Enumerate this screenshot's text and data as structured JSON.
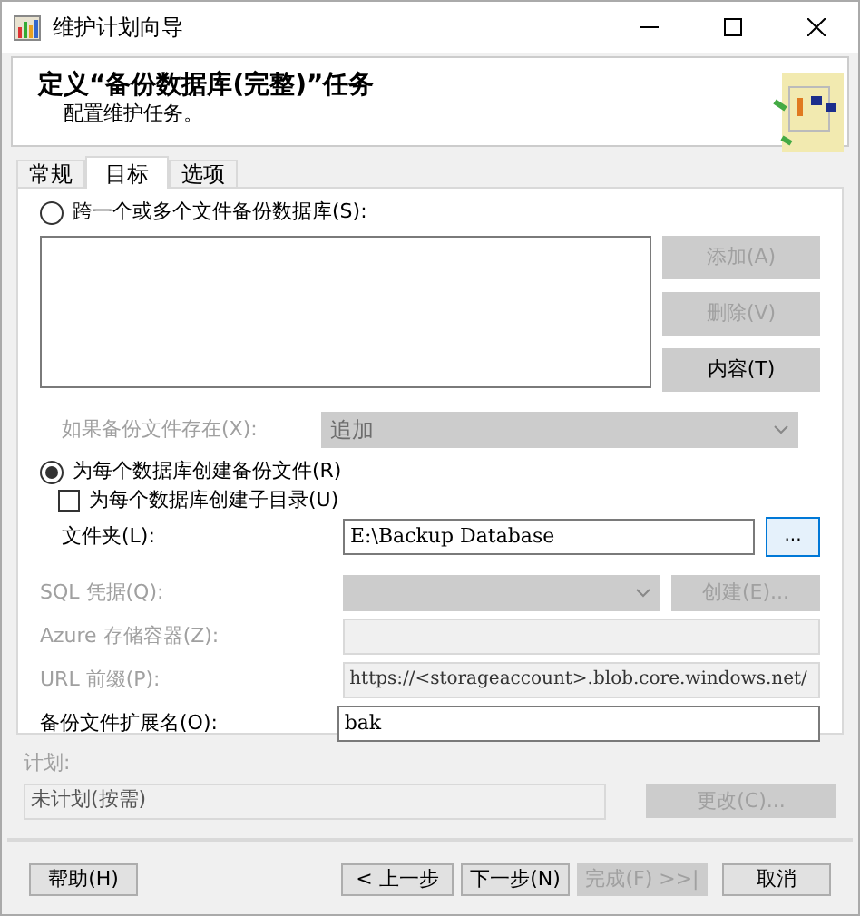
{
  "window": {
    "title": "维护计划向导"
  },
  "header": {
    "title": "定义“备份数据库(完整)”任务",
    "subtitle": "配置维护任务。"
  },
  "tabs": [
    {
      "label": "常规",
      "selected": false
    },
    {
      "label": "目标",
      "selected": true
    },
    {
      "label": "选项",
      "selected": false
    }
  ],
  "across_files": {
    "label": "跨一个或多个文件备份数据库(S):",
    "selected": false
  },
  "file_buttons": [
    {
      "label": "添加(A)",
      "disabled": true
    },
    {
      "label": "删除(V)",
      "disabled": true
    },
    {
      "label": "内容(T)",
      "disabled": false
    }
  ],
  "if_exists": {
    "label": "如果备份文件存在(X):",
    "value": "追加",
    "disabled": true
  },
  "per_database": {
    "label": "为每个数据库创建备份文件(R)",
    "selected": true
  },
  "subdirectory": {
    "label": "为每个数据库创建子目录(U)",
    "checked": false
  },
  "folder": {
    "label": "文件夹(L):",
    "value": "E:\\Backup Database",
    "browse": "..."
  },
  "sql_credential": {
    "label": "SQL 凭据(Q):",
    "disabled": true,
    "create_button": "创建(E)..."
  },
  "azure_container": {
    "label": "Azure 存储容器(Z):",
    "disabled": true
  },
  "url_prefix": {
    "label": "URL 前缀(P):",
    "value": "https://<storageaccount>.blob.core.windows.net/",
    "disabled": true
  },
  "extension": {
    "label": "备份文件扩展名(O):",
    "value": "bak",
    "disabled": false
  },
  "schedule": {
    "label": "计划:",
    "value": "未计划(按需)",
    "disabled": true,
    "change_button": "更改(C)..."
  },
  "footer_buttons": [
    {
      "label": "帮助(H)",
      "disabled": false
    },
    {
      "label": "< 上一步",
      "disabled": false
    },
    {
      "label": "下一步(N)",
      "disabled": false
    },
    {
      "label": "完成(F) >>|",
      "disabled": true
    },
    {
      "label": "取消",
      "disabled": false
    }
  ]
}
